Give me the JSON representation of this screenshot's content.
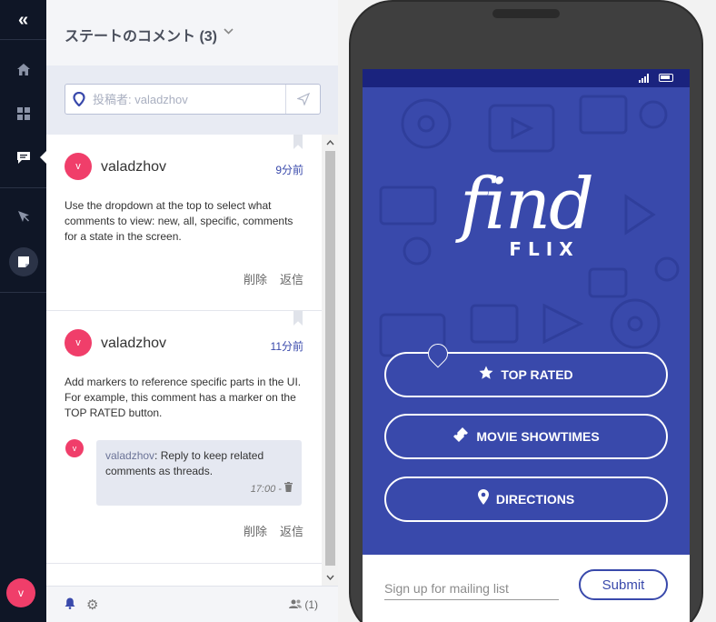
{
  "rail": {
    "collapse_icon": "double-chevron-left-icon",
    "items": [
      "home-icon",
      "grid-icon",
      "comments-icon",
      "cursor-icon",
      "note-icon"
    ],
    "avatar": "v"
  },
  "panel": {
    "title": "ステートのコメント (3)",
    "search_placeholder": "投稿者: valadzhov",
    "comments": [
      {
        "avatar": "v",
        "author": "valadzhov",
        "time": "9分前",
        "body": "Use the dropdown at the top to select what comments to view: new, all, specific, comments for a state in the screen.",
        "delete": "削除",
        "reply": "返信"
      },
      {
        "avatar": "v",
        "author": "valadzhov",
        "time": "11分前",
        "body": "Add markers to reference specific parts in the UI. For example, this comment has a marker on the TOP RATED button.",
        "reply_item": {
          "avatar": "v",
          "author": "valadzhov",
          "text": ": Reply to keep related comments as threads.",
          "time": "17:00 -"
        },
        "delete": "削除",
        "reply": "返信"
      }
    ],
    "footer": {
      "users": "(1)"
    }
  },
  "app": {
    "logo_script": "find",
    "logo_sub": "FLIX",
    "buttons": {
      "top_rated": "TOP RATED",
      "showtimes": "MOVIE SHOWTIMES",
      "directions": "DIRECTIONS"
    },
    "signup_placeholder": "Sign up for mailing list",
    "submit": "Submit",
    "colors": {
      "primary": "#3949ab",
      "statusbar": "#1a237e",
      "avatar": "#f03e6a"
    }
  }
}
